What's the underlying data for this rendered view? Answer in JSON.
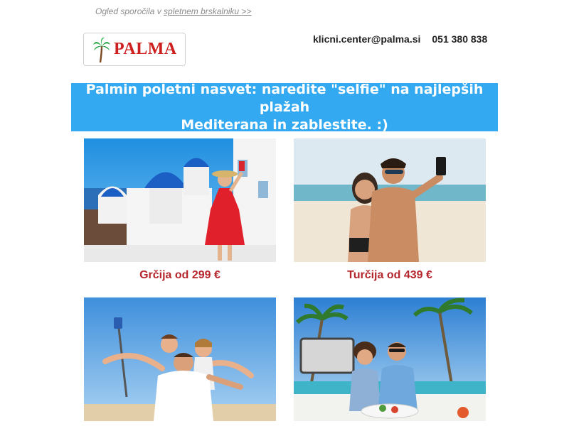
{
  "preheader": {
    "text": "Ogled sporočila v ",
    "link": "spletnem brskalniku >>"
  },
  "logo": {
    "text": "PALMA",
    "icon": "palm-tree-icon"
  },
  "contact": {
    "email": "klicni.center@palma.si",
    "phone": "051 380 838"
  },
  "banner": {
    "line1": "Palmin poletni nasvet: naredite \"selfie\" na najlepših plažah",
    "line2": "Mediterana in zablestite. :)"
  },
  "offers": [
    {
      "title": "Grčija od 299 €",
      "image": "santorini-selfie"
    },
    {
      "title": "Turčija od 439 €",
      "image": "beach-couple-selfie"
    },
    {
      "title": "",
      "image": "family-selfie-stick"
    },
    {
      "title": "",
      "image": "resort-couple-selfie"
    }
  ],
  "colors": {
    "banner": "#33a9f2",
    "caption": "#b5272d",
    "logo": "#cc1f1f"
  }
}
